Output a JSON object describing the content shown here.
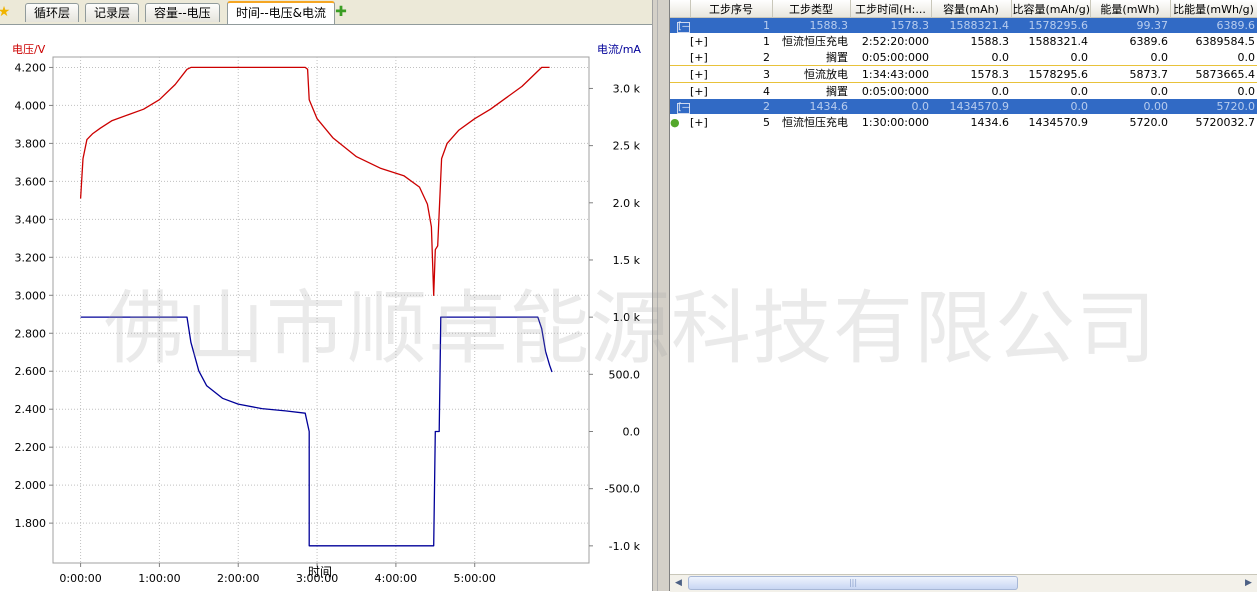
{
  "tabs": [
    {
      "label": "循环层"
    },
    {
      "label": "记录层"
    },
    {
      "label": "容量--电压"
    },
    {
      "label": "时间--电压&电流"
    }
  ],
  "icons": {
    "left_star": "star-icon",
    "add_tab": "add-star-icon",
    "bulb": "lightbulb-icon"
  },
  "colors": {
    "voltage": "#cc0000",
    "current": "#000099",
    "selection": "#316ac5",
    "highlight_border": "#e8c23a"
  },
  "chart_data": {
    "type": "line",
    "xlabel": "时间",
    "ylabel_left": "电压/V",
    "ylabel_right": "电流/mA",
    "x_ticks": [
      "0:00:00",
      "1:00:00",
      "2:00:00",
      "3:00:00",
      "4:00:00",
      "5:00:00"
    ],
    "y_left_ticks": [
      "4.200",
      "4.000",
      "3.800",
      "3.600",
      "3.400",
      "3.200",
      "3.000",
      "2.800",
      "2.600",
      "2.400",
      "2.200",
      "2.000",
      "1.800"
    ],
    "y_right_ticks": [
      "3.0 k",
      "2.5 k",
      "2.0 k",
      "1.5 k",
      "1.0 k",
      "500.0",
      "0.0",
      "-500.0",
      "-1.0 k"
    ],
    "xlim": [
      -0.35,
      6.45
    ],
    "ylim_left": [
      1.59,
      4.255
    ],
    "ylim_right": [
      -1150,
      3275
    ],
    "grid": true,
    "series": [
      {
        "name": "电压/V",
        "axis": "left",
        "points": [
          [
            0,
            3.51
          ],
          [
            0.03,
            3.72
          ],
          [
            0.08,
            3.82
          ],
          [
            0.15,
            3.85
          ],
          [
            0.25,
            3.88
          ],
          [
            0.4,
            3.92
          ],
          [
            0.6,
            3.95
          ],
          [
            0.8,
            3.98
          ],
          [
            1.0,
            4.03
          ],
          [
            1.2,
            4.11
          ],
          [
            1.35,
            4.19
          ],
          [
            1.4,
            4.2
          ],
          [
            2.0,
            4.2
          ],
          [
            2.5,
            4.2
          ],
          [
            2.85,
            4.2
          ],
          [
            2.88,
            4.19
          ],
          [
            2.9,
            4.03
          ],
          [
            3.0,
            3.93
          ],
          [
            3.2,
            3.83
          ],
          [
            3.5,
            3.73
          ],
          [
            3.8,
            3.67
          ],
          [
            4.1,
            3.63
          ],
          [
            4.3,
            3.57
          ],
          [
            4.4,
            3.48
          ],
          [
            4.45,
            3.36
          ],
          [
            4.48,
            3.0
          ],
          [
            4.5,
            3.24
          ],
          [
            4.53,
            3.26
          ],
          [
            4.58,
            3.72
          ],
          [
            4.65,
            3.8
          ],
          [
            4.8,
            3.87
          ],
          [
            5.0,
            3.93
          ],
          [
            5.2,
            3.98
          ],
          [
            5.4,
            4.04
          ],
          [
            5.6,
            4.1
          ],
          [
            5.75,
            4.16
          ],
          [
            5.85,
            4.2
          ],
          [
            5.95,
            4.2
          ]
        ]
      },
      {
        "name": "电流/mA",
        "axis": "right",
        "points": [
          [
            0,
            1000
          ],
          [
            1.35,
            1000
          ],
          [
            1.4,
            780
          ],
          [
            1.5,
            530
          ],
          [
            1.6,
            400
          ],
          [
            1.8,
            290
          ],
          [
            2.0,
            240
          ],
          [
            2.3,
            200
          ],
          [
            2.6,
            180
          ],
          [
            2.85,
            160
          ],
          [
            2.9,
            0
          ],
          [
            2.9,
            -1000
          ],
          [
            4.48,
            -1000
          ],
          [
            4.5,
            0
          ],
          [
            4.55,
            0
          ],
          [
            4.57,
            1000
          ],
          [
            5.8,
            1000
          ],
          [
            5.85,
            900
          ],
          [
            5.9,
            700
          ],
          [
            5.95,
            580
          ],
          [
            5.98,
            520
          ]
        ]
      }
    ]
  },
  "table": {
    "headers": [
      "",
      "工步序号",
      "工步类型",
      "工步时间(H:...",
      "容量(mAh)",
      "比容量(mAh/g)",
      "能量(mWh)",
      "比能量(mWh/g)"
    ],
    "rows": [
      {
        "kind": "cycle",
        "expander": "[—]",
        "cells": [
          "1",
          "1588.3",
          "1578.3",
          "1588321.4",
          "1578295.6",
          "99.37",
          "6389.6"
        ]
      },
      {
        "kind": "step",
        "expander": "[+]",
        "cells": [
          "1",
          "恒流恒压充电",
          "2:52:20:000",
          "1588.3",
          "1588321.4",
          "6389.6",
          "6389584.5"
        ]
      },
      {
        "kind": "step",
        "expander": "[+]",
        "cells": [
          "2",
          "搁置",
          "0:05:00:000",
          "0.0",
          "0.0",
          "0.0",
          "0.0"
        ]
      },
      {
        "kind": "step-sel",
        "expander": "[+]",
        "cells": [
          "3",
          "恒流放电",
          "1:34:43:000",
          "1578.3",
          "1578295.6",
          "5873.7",
          "5873665.4"
        ]
      },
      {
        "kind": "step",
        "expander": "[+]",
        "cells": [
          "4",
          "搁置",
          "0:05:00:000",
          "0.0",
          "0.0",
          "0.0",
          "0.0"
        ]
      },
      {
        "kind": "cycle",
        "expander": "[—]",
        "cells": [
          "2",
          "1434.6",
          "0.0",
          "1434570.9",
          "0.0",
          "0.00",
          "5720.0"
        ]
      },
      {
        "kind": "step",
        "expander": "[+]",
        "cells": [
          "5",
          "恒流恒压充电",
          "1:30:00:000",
          "1434.6",
          "1434570.9",
          "5720.0",
          "5720032.7"
        ]
      }
    ]
  },
  "scrollbar": {
    "thumb_grip": "|||",
    "left_arrow": "◀",
    "right_arrow": "▶"
  },
  "watermark": "佛山市顺卓能源科技有限公司"
}
